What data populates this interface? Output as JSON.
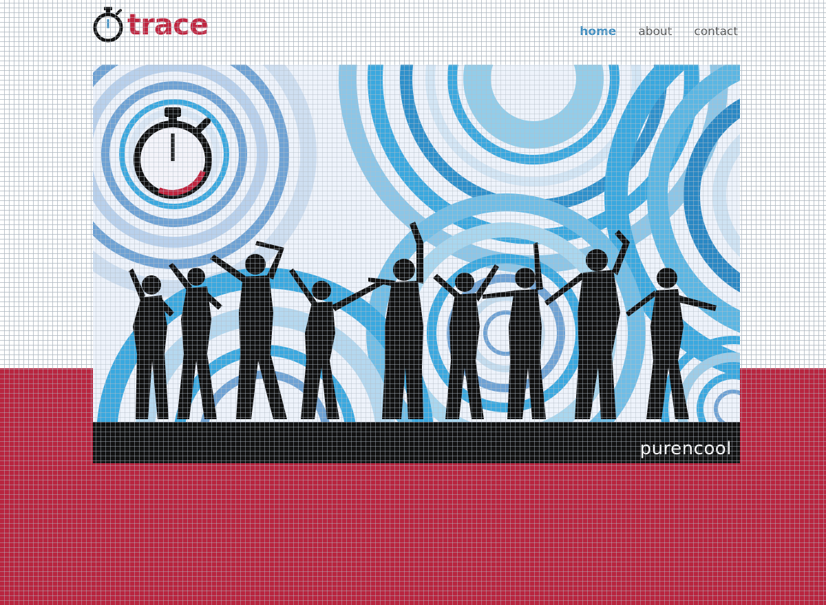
{
  "header": {
    "logo_text": "trace",
    "nav": [
      {
        "label": "home",
        "active": true
      },
      {
        "label": "about",
        "active": false
      },
      {
        "label": "contact",
        "active": false
      }
    ]
  },
  "hero": {
    "caption": "purencool"
  },
  "colors": {
    "brand_red": "#c0253f",
    "band_red": "#b8253f",
    "nav_active": "#3f8fc2",
    "hero_blue": "#3aa8df"
  }
}
